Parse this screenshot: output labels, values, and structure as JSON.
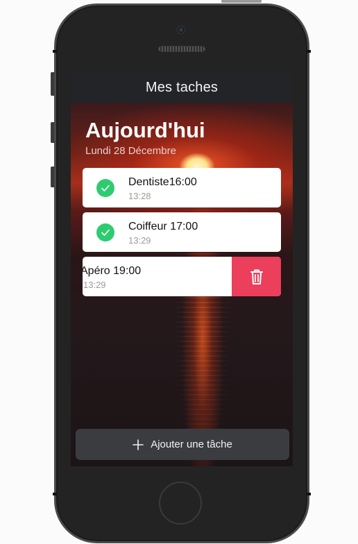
{
  "app": {
    "title": "Mes taches"
  },
  "header": {
    "heading": "Aujourd'hui",
    "date": "Lundi 28 Décembre"
  },
  "tasks": [
    {
      "title": "Dentiste16:00",
      "time": "13:28",
      "done": true,
      "state": "normal"
    },
    {
      "title": "Coiffeur 17:00",
      "time": "13:29",
      "done": true,
      "state": "normal"
    },
    {
      "title": "Apéro 19:00",
      "time": "13:29",
      "done": false,
      "state": "swiped-delete"
    }
  ],
  "actions": {
    "add_task_label": "Ajouter une tâche",
    "delete_icon": "trash-icon",
    "add_icon": "plus-icon",
    "check_icon": "check-icon"
  },
  "colors": {
    "navbar": "#232427",
    "done_green": "#2ecc71",
    "delete_red": "#ec3f5b",
    "add_button": "#3b3c40"
  }
}
